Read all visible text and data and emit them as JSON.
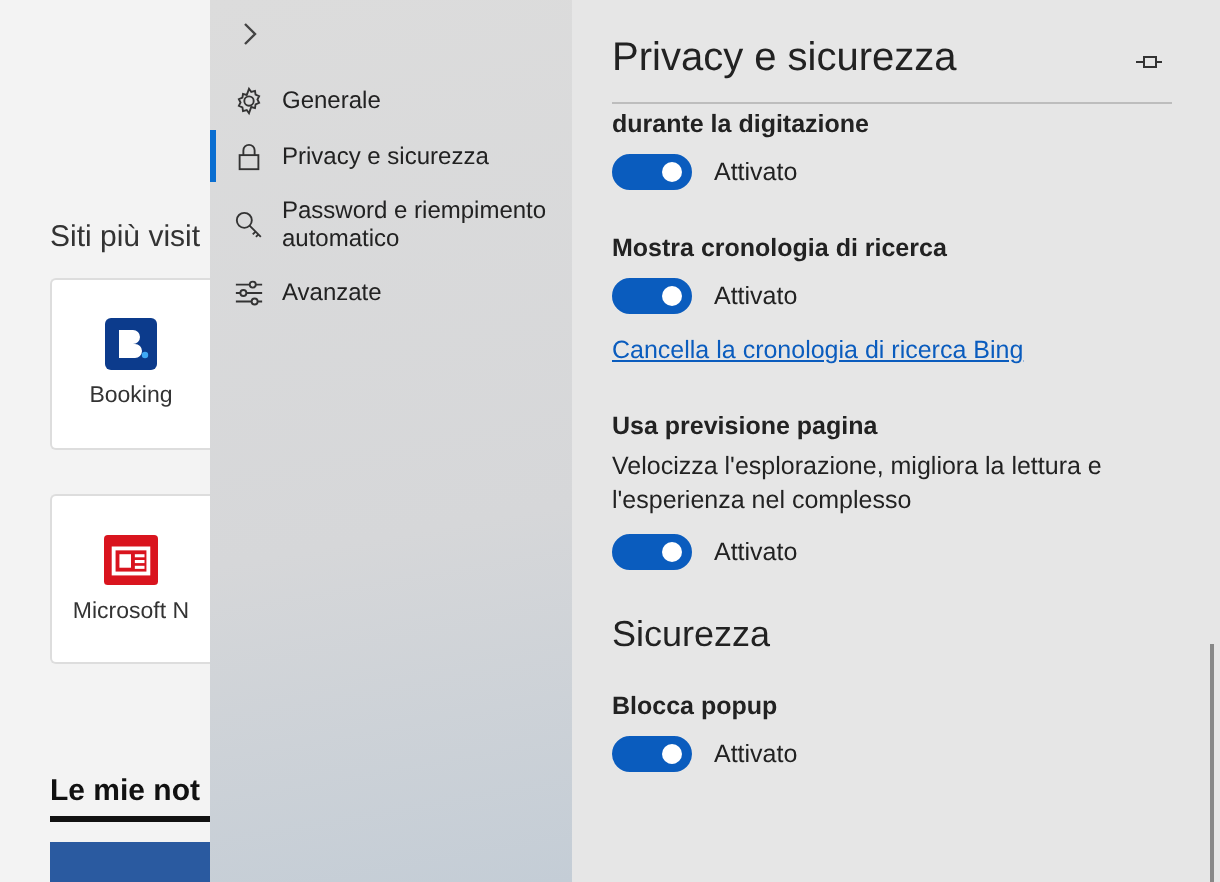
{
  "background_page": {
    "section_title": "Siti più visit",
    "tiles": [
      {
        "label": "Booking",
        "kind": "booking"
      },
      {
        "label": "Microsoft N",
        "kind": "news"
      }
    ],
    "news_heading": "Le mie not"
  },
  "sidebar": {
    "items": [
      {
        "label": "Generale",
        "selected": false
      },
      {
        "label": "Privacy e sicurezza",
        "selected": true
      },
      {
        "label": "Password e riempimento automatico",
        "selected": false
      },
      {
        "label": "Avanzate",
        "selected": false
      }
    ]
  },
  "panel": {
    "title": "Privacy e sicurezza",
    "sections": [
      {
        "settings": [
          {
            "label": "durante la digitazione",
            "on": true,
            "state_text": "Attivato"
          },
          {
            "label": "Mostra cronologia di ricerca",
            "on": true,
            "state_text": "Attivato",
            "link": "Cancella la cronologia di ricerca Bing"
          },
          {
            "label": "Usa previsione pagina",
            "description": "Velocizza l'esplorazione, migliora la lettura e l'esperienza nel complesso",
            "on": true,
            "state_text": "Attivato"
          }
        ]
      },
      {
        "heading": "Sicurezza",
        "settings": [
          {
            "label": "Blocca popup",
            "on": true,
            "state_text": "Attivato"
          }
        ]
      }
    ]
  }
}
